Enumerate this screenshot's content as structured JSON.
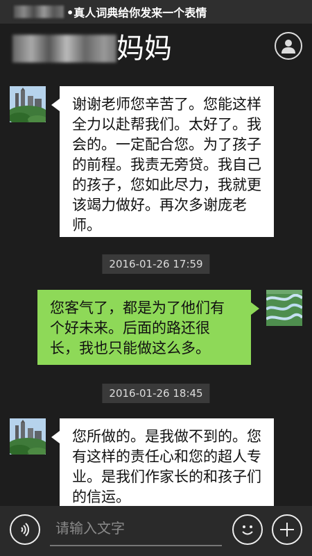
{
  "status_bar": {
    "notification": "•真人词典给你发来一个表情"
  },
  "header": {
    "title_suffix": "妈妈",
    "profile_icon": "person-icon"
  },
  "messages": [
    {
      "direction": "incoming",
      "text": "谢谢老师您辛苦了。您能这样全力以赴帮我们。太好了。我会的。一定配合您。为了孩子的前程。我责无旁贷。我自己的孩子，您如此尽力，我就更该竭力做好。再次多谢庞老师。"
    },
    {
      "timestamp": "2016-01-26 17:59"
    },
    {
      "direction": "outgoing",
      "text": "您客气了，都是为了他们有个好未来。后面的路还很长，我也只能做这么多。"
    },
    {
      "timestamp": "2016-01-26 18:45"
    },
    {
      "direction": "incoming",
      "text": "您所做的。是我做不到的。您有这样的责任心和您的超人专业。是我们作家长的和孩子们的信运。"
    }
  ],
  "input_bar": {
    "placeholder": "请输入文字",
    "voice_icon": "voice-icon",
    "emoji_icon": "emoji-icon",
    "add_icon": "plus-icon"
  }
}
